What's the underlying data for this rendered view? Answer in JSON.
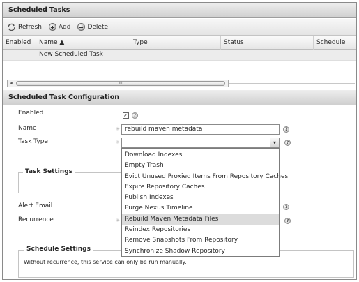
{
  "top_panel": {
    "title": "Scheduled Tasks"
  },
  "toolbar": {
    "refresh_label": "Refresh",
    "add_label": "Add",
    "delete_label": "Delete"
  },
  "grid": {
    "columns": [
      "Enabled",
      "Name ▲",
      "Type",
      "Status",
      "Schedule"
    ],
    "rows": [
      {
        "name": "New Scheduled Task"
      }
    ]
  },
  "scrollbar": {
    "left_arrow": "◂",
    "grip": "III"
  },
  "config_panel": {
    "title": "Scheduled Task Configuration",
    "enabled_label": "Enabled",
    "enabled_checked": true,
    "checkmark": "✓",
    "name_label": "Name",
    "name_value": "rebuild maven metadata",
    "task_type_label": "Task Type",
    "task_type_value": "",
    "help_glyph": "?",
    "required_glyph": "✳",
    "dropdown_arrow": "▾",
    "task_settings_legend": "Task Settings",
    "alert_email_label": "Alert Email",
    "recurrence_label": "Recurrence",
    "schedule_settings_legend": "Schedule Settings",
    "schedule_note": "Without recurrence, this service can only be run manually."
  },
  "task_type_options": [
    "Download Indexes",
    "Empty Trash",
    "Evict Unused Proxied Items From Repository Caches",
    "Expire Repository Caches",
    "Publish Indexes",
    "Purge Nexus Timeline",
    "Rebuild Maven Metadata Files",
    "Reindex Repositories",
    "Remove Snapshots From Repository",
    "Synchronize Shadow Repository"
  ],
  "highlighted_option": "Rebuild Maven Metadata Files"
}
